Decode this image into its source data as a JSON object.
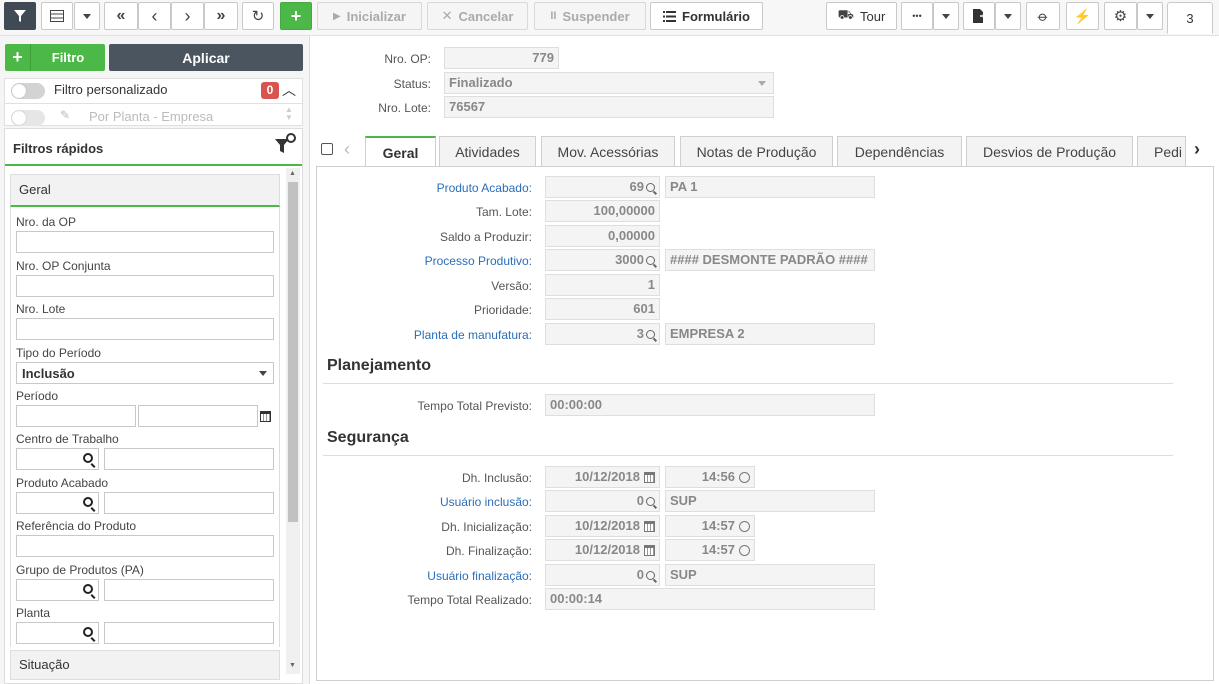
{
  "toolbar": {
    "inicializar": "Inicializar",
    "cancelar": "Cancelar",
    "suspender": "Suspender",
    "formulario": "Formulário",
    "tour": "Tour",
    "more": "•••",
    "counter": "3"
  },
  "left": {
    "filtro_button": "Filtro",
    "aplicar_button": "Aplicar",
    "filtro_personalizado": "Filtro personalizado",
    "filtro_count": "0",
    "por_planta": "Por Planta - Empresa",
    "filtros_rapidos": "Filtros rápidos",
    "geral": "Geral",
    "fields": {
      "nro_op": "Nro. da OP",
      "nro_op_conjunta": "Nro. OP Conjunta",
      "nro_lote": "Nro. Lote",
      "tipo_periodo": "Tipo do Período",
      "tipo_periodo_value": "Inclusão",
      "periodo": "Período",
      "centro_trabalho": "Centro de Trabalho",
      "produto_acabado": "Produto Acabado",
      "referencia_produto": "Referência do Produto",
      "grupo_produtos": "Grupo de Produtos (PA)",
      "planta": "Planta"
    },
    "situacao": "Situação"
  },
  "header": {
    "nro_op_label": "Nro. OP:",
    "nro_op_value": "779",
    "status_label": "Status:",
    "status_value": "Finalizado",
    "nro_lote_label": "Nro. Lote:",
    "nro_lote_value": "76567"
  },
  "tabs": [
    "Geral",
    "Atividades",
    "Mov. Acessórias",
    "Notas de Produção",
    "Dependências",
    "Desvios de Produção",
    "Pedi"
  ],
  "geral": {
    "produto_acabado_label": "Produto Acabado:",
    "produto_acabado_code": "69",
    "produto_acabado_desc": "PA 1",
    "tam_lote_label": "Tam. Lote:",
    "tam_lote_value": "100,00000",
    "saldo_label": "Saldo a Produzir:",
    "saldo_value": "0,00000",
    "processo_label": "Processo Produtivo:",
    "processo_code": "3000",
    "processo_desc": "#### DESMONTE PADRÃO ####",
    "versao_label": "Versão:",
    "versao_value": "1",
    "prioridade_label": "Prioridade:",
    "prioridade_value": "601",
    "planta_label": "Planta de manufatura:",
    "planta_code": "3",
    "planta_desc": "EMPRESA 2"
  },
  "planejamento": {
    "title": "Planejamento",
    "tempo_previsto_label": "Tempo Total Previsto:",
    "tempo_previsto_value": "00:00:00"
  },
  "seguranca": {
    "title": "Segurança",
    "dh_inclusao_label": "Dh. Inclusão:",
    "dh_inclusao_date": "10/12/2018",
    "dh_inclusao_time": "14:56",
    "usuario_inclusao_label": "Usuário inclusão:",
    "usuario_inclusao_code": "0",
    "usuario_inclusao_name": "SUP",
    "dh_inicializacao_label": "Dh. Inicialização:",
    "dh_inicializacao_date": "10/12/2018",
    "dh_inicializacao_time": "14:57",
    "dh_finalizacao_label": "Dh. Finalização:",
    "dh_finalizacao_date": "10/12/2018",
    "dh_finalizacao_time": "14:57",
    "usuario_finalizacao_label": "Usuário finalização:",
    "usuario_finalizacao_code": "0",
    "usuario_finalizacao_name": "SUP",
    "tempo_realizado_label": "Tempo Total Realizado:",
    "tempo_realizado_value": "00:00:14"
  }
}
